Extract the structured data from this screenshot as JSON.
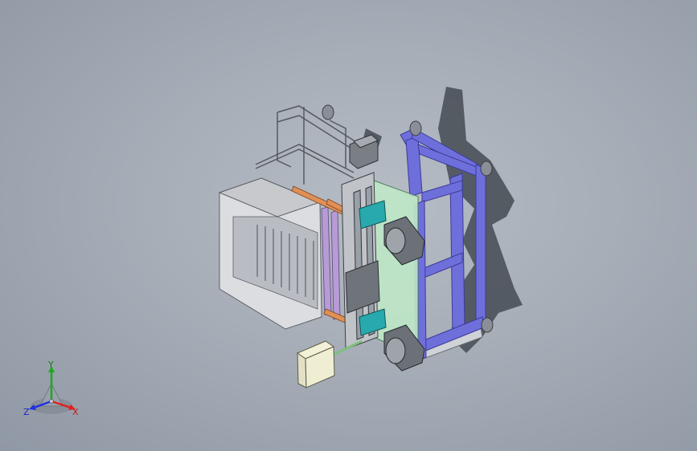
{
  "triad": {
    "x_label": "X",
    "y_label": "Y",
    "z_label": "Z",
    "colors": {
      "x": "#e02020",
      "y": "#20b020",
      "z": "#2030e0"
    }
  },
  "model": {
    "colors": {
      "background": "#a8afb8",
      "frame_blue": "#6b6bd8",
      "steel": "#c9ccd1",
      "glass_green": "#bfe8c8",
      "accent_orange": "#e08a4a",
      "accent_teal": "#2aa8a8",
      "shadow": "#4a5058"
    }
  }
}
